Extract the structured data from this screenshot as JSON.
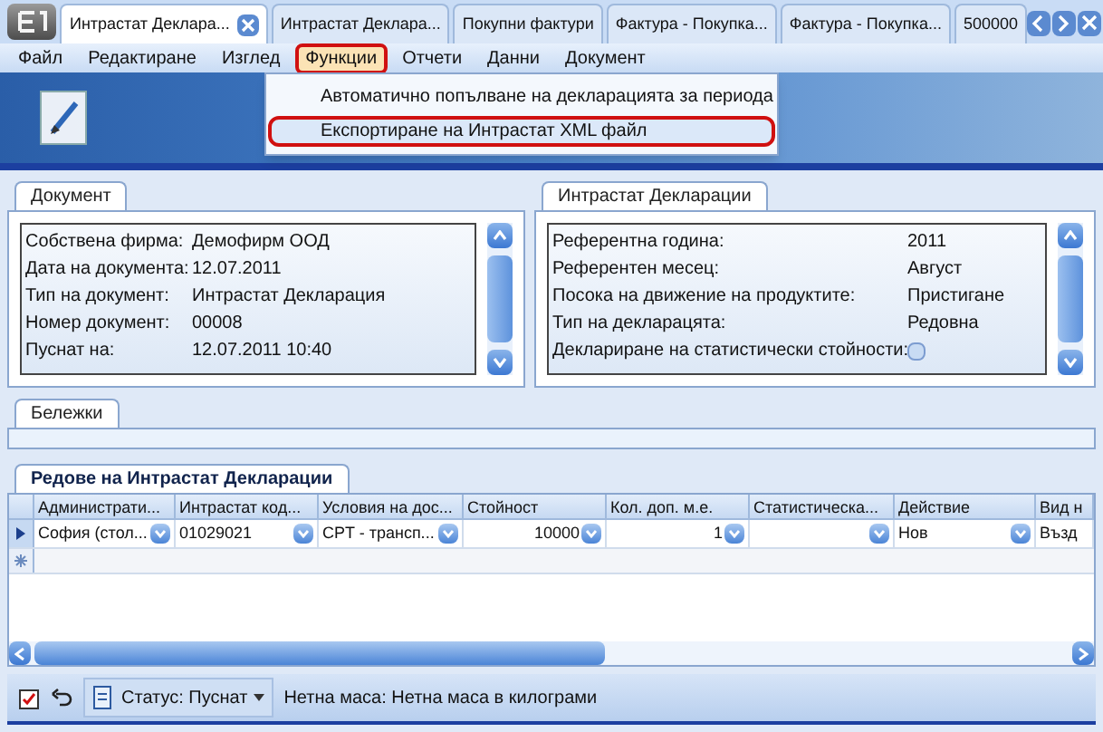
{
  "doc_tabs": [
    {
      "label": "Интрастат Деклара...",
      "selected": true,
      "closable": true
    },
    {
      "label": "Интрастат Деклара...",
      "selected": false,
      "closable": false
    },
    {
      "label": "Покупни фактури",
      "selected": false,
      "closable": false
    },
    {
      "label": "Фактура - Покупка...",
      "selected": false,
      "closable": false
    },
    {
      "label": "Фактура - Покупка...",
      "selected": false,
      "closable": false
    },
    {
      "label": "500000",
      "selected": false,
      "closable": false
    }
  ],
  "menu": [
    {
      "label": "Файл",
      "selected": false
    },
    {
      "label": "Редактиране",
      "selected": false
    },
    {
      "label": "Изглед",
      "selected": false
    },
    {
      "label": "Функции",
      "selected": true
    },
    {
      "label": "Отчети",
      "selected": false
    },
    {
      "label": "Данни",
      "selected": false
    },
    {
      "label": "Документ",
      "selected": false
    }
  ],
  "dropdown": [
    {
      "label": "Автоматично попълване на декларацията за периода",
      "selected": false
    },
    {
      "label": "Експортиране на Интрастат XML файл",
      "selected": true
    }
  ],
  "document_panel": {
    "tab": "Документ",
    "fields": [
      {
        "label": "Собствена фирма:",
        "value": "Демофирм ООД"
      },
      {
        "label": "Дата на документа:",
        "value": "12.07.2011"
      },
      {
        "label": "Тип на документ:",
        "value": "Интрастат Декларация"
      },
      {
        "label": "Номер документ:",
        "value": "00008"
      },
      {
        "label": "Пуснат на:",
        "value": "12.07.2011 10:40"
      }
    ]
  },
  "intrastat_panel": {
    "tab": "Интрастат Декларации",
    "fields": [
      {
        "kind": "text",
        "label": "Референтна година:",
        "value": "2011"
      },
      {
        "kind": "text",
        "label": "Референтен месец:",
        "value": "Август"
      },
      {
        "kind": "text",
        "label": "Посока на движение на продуктите:",
        "value": "Пристигане"
      },
      {
        "kind": "text",
        "label": "Тип на декларацята:",
        "value": "Редовна"
      },
      {
        "kind": "checkbox",
        "label": "Деклариране на статистически стойности:",
        "checked": false
      }
    ]
  },
  "notes_panel": {
    "tab": "Бележки"
  },
  "lines_panel": {
    "tab": "Редове на Интрастат Декларации",
    "columns": [
      "Администрати...",
      "Интрастат код...",
      "Условия на дос...",
      "Стойност",
      "Кол. доп. м.е.",
      "Статистическа...",
      "Действие",
      "Вид н"
    ],
    "rows": [
      {
        "selected": true,
        "cells": [
          {
            "kind": "text",
            "value": "София (стол...",
            "dropdown": true
          },
          {
            "kind": "text",
            "value": "01029021",
            "dropdown": true
          },
          {
            "kind": "text",
            "value": "CPT - трансп...",
            "dropdown": true
          },
          {
            "kind": "number",
            "value": "10000",
            "dropdown": true
          },
          {
            "kind": "number",
            "value": "1",
            "dropdown": true
          },
          {
            "kind": "text",
            "dropdown": true
          },
          {
            "kind": "text",
            "value": "Нов",
            "dropdown": true
          },
          {
            "kind": "text",
            "value": "Възд",
            "dropdown": false
          }
        ]
      }
    ]
  },
  "status_bar": {
    "status": "Статус: Пуснат",
    "message": "Нетна маса: Нетна маса в килограми"
  }
}
